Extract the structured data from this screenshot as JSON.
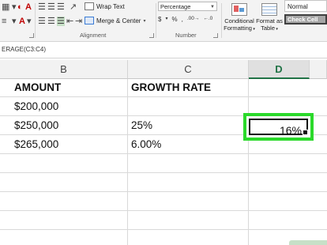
{
  "ribbon": {
    "alignment": {
      "label": "Alignment",
      "wrap_text": "Wrap Text",
      "merge_center": "Merge & Center"
    },
    "number": {
      "label": "Number",
      "format_value": "Percentage",
      "currency_symbol": "$",
      "percent_symbol": "%",
      "comma_symbol": ",",
      "inc_decimal": ".00→",
      "dec_decimal": "←.0"
    },
    "styles": {
      "conditional_formatting_line1": "Conditional",
      "conditional_formatting_line2": "Formatting",
      "format_as_table_line1": "Format as",
      "format_as_table_line2": "Table",
      "normal": "Normal",
      "check_cell": "Check Cell"
    }
  },
  "formula_bar": {
    "text": "ERAGE(C3:C4)"
  },
  "columns": [
    {
      "label": "B"
    },
    {
      "label": "C"
    },
    {
      "label": "D"
    }
  ],
  "cells": {
    "b_header": "AMOUNT",
    "c_header": "GROWTH RATE",
    "b1": "$200,000",
    "b2": "$250,000",
    "b3": "$265,000",
    "c2": "25%",
    "c3": "6.00%",
    "d_selected": "16%"
  },
  "colors": {
    "highlight": "#2bd92b",
    "excel_green": "#217346"
  }
}
